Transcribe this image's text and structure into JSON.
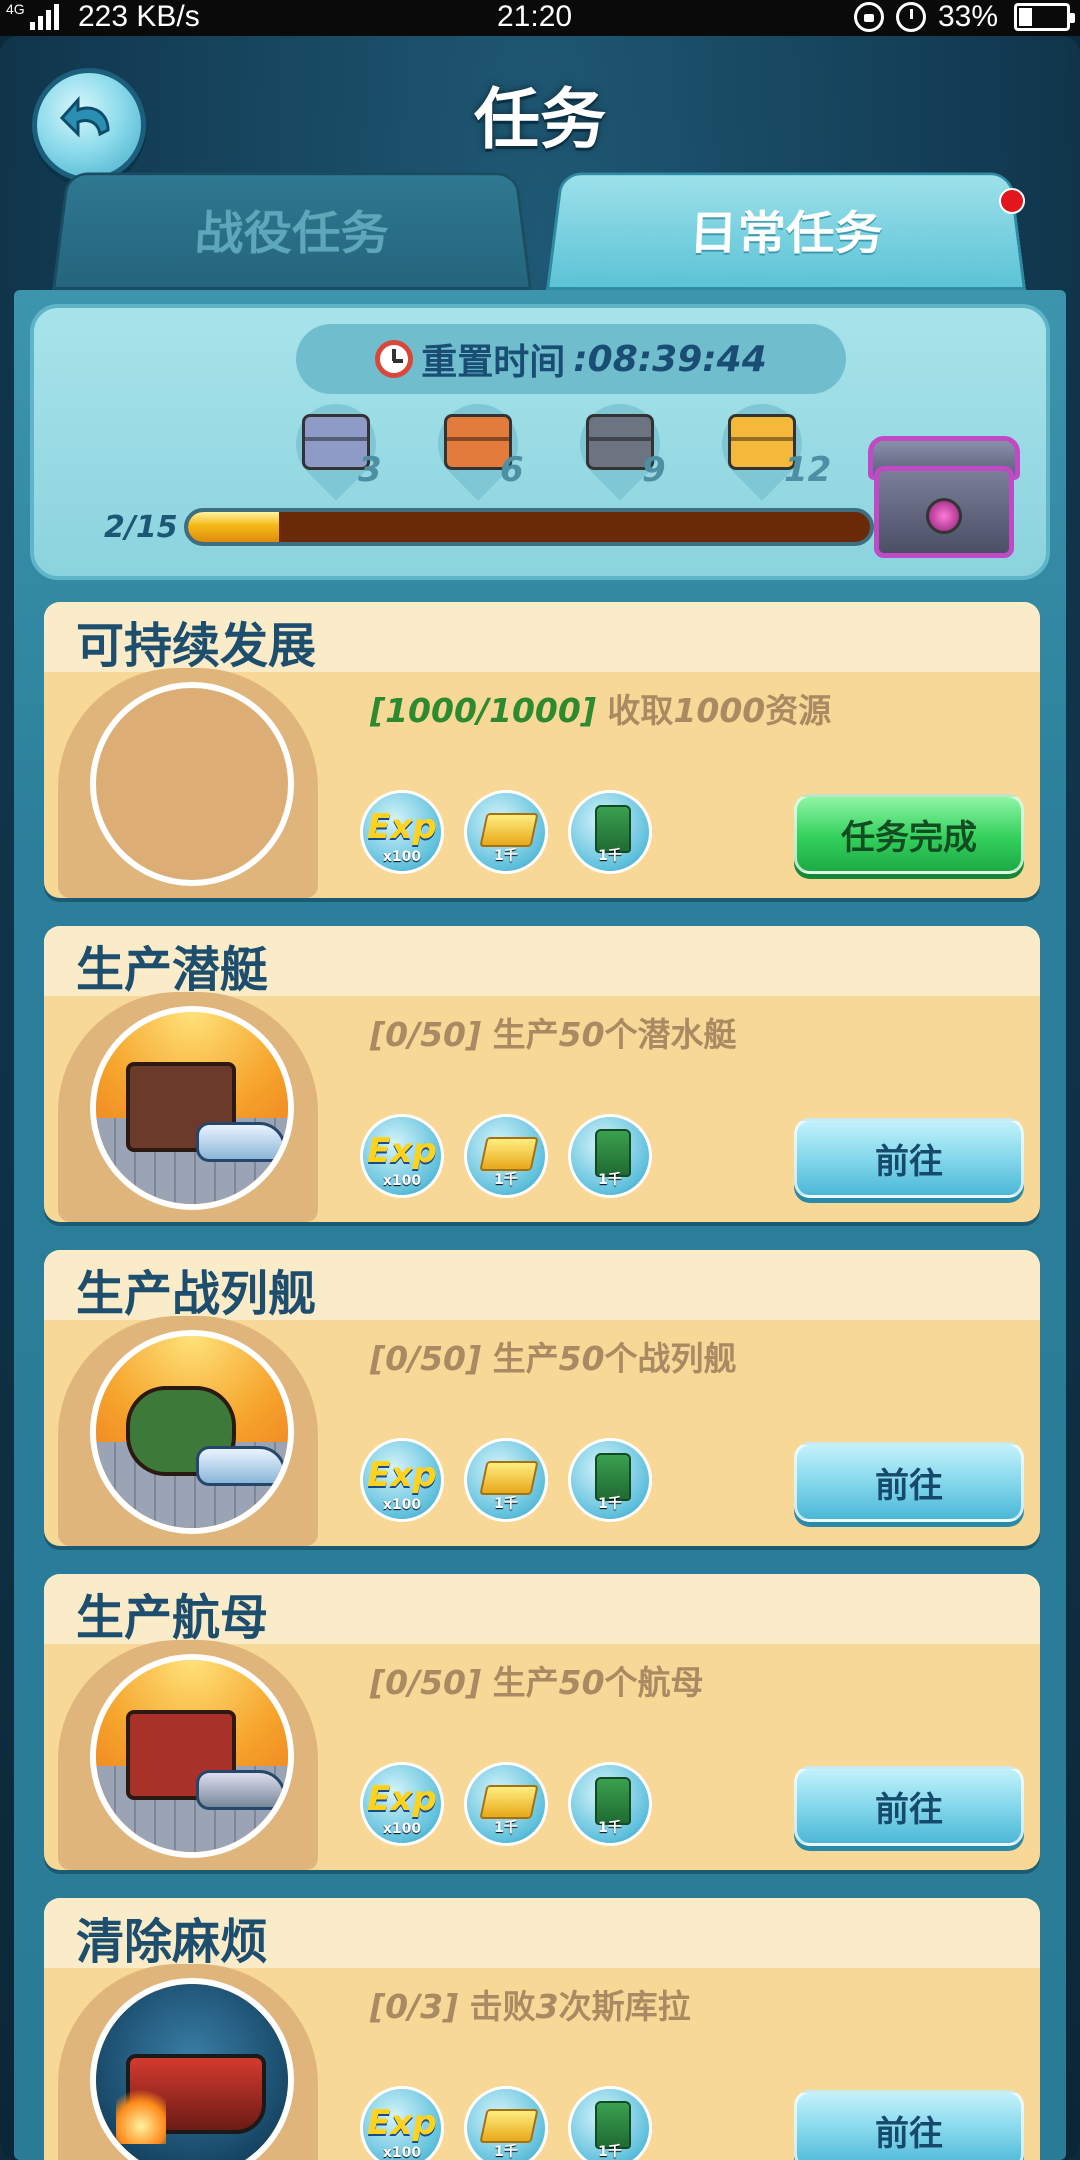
{
  "status_bar": {
    "network": "4G",
    "speed": "223 KB/s",
    "time": "21:20",
    "battery": "33%",
    "battery_level": 0.33
  },
  "header": {
    "title": "任务",
    "back_icon": "back-arrow-icon"
  },
  "tabs": [
    {
      "label": "战役任务",
      "active": false
    },
    {
      "label": "日常任务",
      "active": true,
      "has_notification": true
    }
  ],
  "progress": {
    "reset_label": "重置时间",
    "reset_time": ":08:39:44",
    "count": "2/15",
    "current": 2,
    "total": 15,
    "chests": [
      {
        "threshold": "3",
        "color": "#8e9bc7"
      },
      {
        "threshold": "6",
        "color": "#e27b3b"
      },
      {
        "threshold": "9",
        "color": "#6b7480"
      },
      {
        "threshold": "12",
        "color": "#f4b93a"
      }
    ]
  },
  "rewards": {
    "exp": {
      "glyph": "Exp",
      "label": "x100"
    },
    "gold": {
      "label": "1千"
    },
    "oil": {
      "label": "1千"
    }
  },
  "tasks": [
    {
      "title": "可持续发展",
      "progress": "[1000/1000]",
      "desc_pre": " 收取",
      "desc_num": "1000",
      "desc_post": "资源",
      "button": "任务完成",
      "done": true
    },
    {
      "title": "生产潜艇",
      "progress": "[0/50]",
      "desc_pre": " 生产",
      "desc_num": "50",
      "desc_post": "个潜水艇",
      "button": "前往",
      "done": false
    },
    {
      "title": "生产战列舰",
      "progress": "[0/50]",
      "desc_pre": " 生产",
      "desc_num": "50",
      "desc_post": "个战列舰",
      "button": "前往",
      "done": false
    },
    {
      "title": "生产航母",
      "progress": "[0/50]",
      "desc_pre": " 生产",
      "desc_num": "50",
      "desc_post": "个航母",
      "button": "前往",
      "done": false
    },
    {
      "title": "清除麻烦",
      "progress": "[0/3]",
      "desc_pre": " 击败",
      "desc_num": "3",
      "desc_post": "次斯库拉",
      "button": "前往",
      "done": false
    }
  ]
}
